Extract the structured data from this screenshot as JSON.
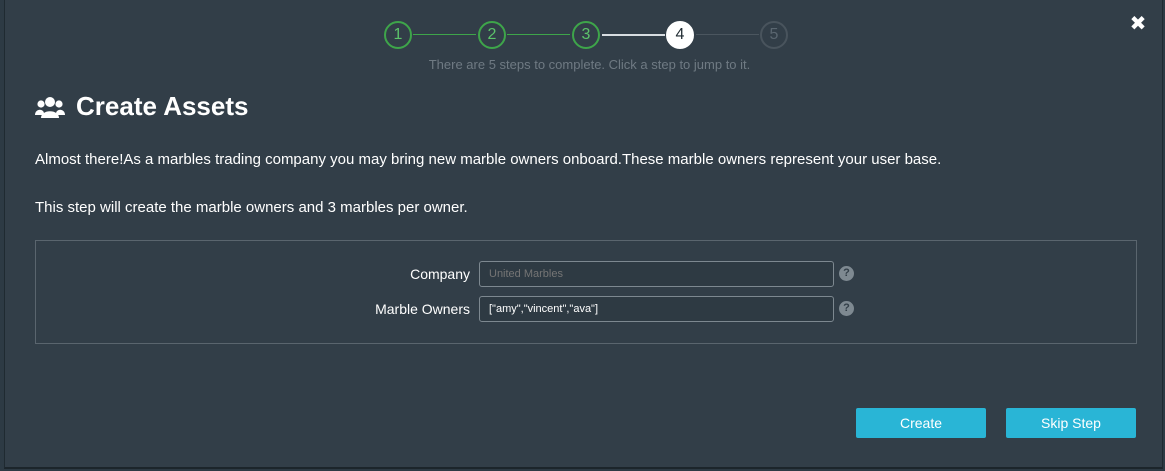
{
  "close": {
    "glyph": "✖"
  },
  "stepper": {
    "steps": [
      {
        "label": "1",
        "state": "done"
      },
      {
        "label": "2",
        "state": "done"
      },
      {
        "label": "3",
        "state": "done"
      },
      {
        "label": "4",
        "state": "current"
      },
      {
        "label": "5",
        "state": "future"
      }
    ],
    "hint": "There are 5 steps to complete. Click a step to jump to it."
  },
  "header": {
    "icon": "users-icon",
    "title": "Create Assets"
  },
  "body": {
    "paragraph1": "Almost there!As a marbles trading company you may bring new marble owners onboard.These marble owners represent your user base.",
    "paragraph2": "This step will create the marble owners and 3 marbles per owner."
  },
  "form": {
    "company": {
      "label": "Company",
      "value": "",
      "placeholder": "United Marbles"
    },
    "owners": {
      "label": "Marble Owners",
      "value": "[\"amy\",\"vincent\",\"ava\"]"
    },
    "help_glyph": "?"
  },
  "buttons": {
    "create": "Create",
    "skip": "Skip Step"
  },
  "colors": {
    "done": "#3ea54a",
    "accent": "#29b5d6",
    "background": "#323e48"
  }
}
